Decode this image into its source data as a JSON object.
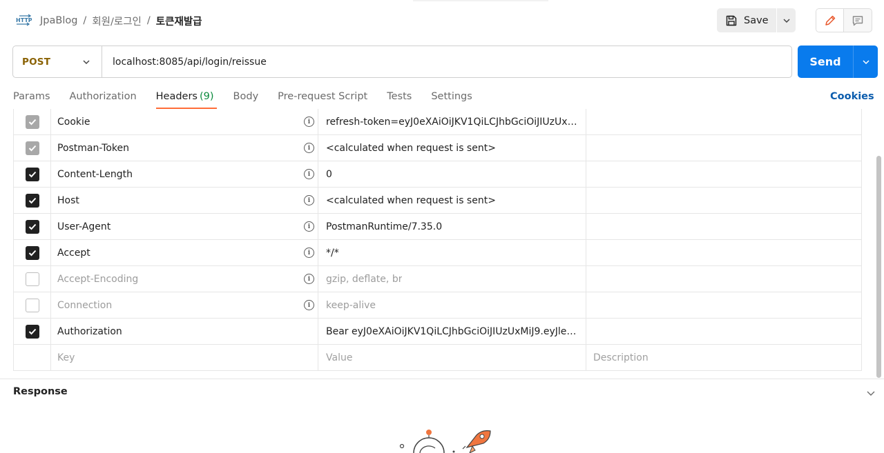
{
  "header": {
    "breadcrumb": [
      {
        "label": "JpaBlog",
        "kind": "crumb"
      },
      {
        "label": "회원/로그인",
        "kind": "crumb"
      },
      {
        "label": "토큰재발급",
        "kind": "current"
      }
    ],
    "separator": "/",
    "save_label": "Save",
    "icons": {
      "request_type": "http-icon",
      "save": "save-icon",
      "edit": "pencil-icon",
      "comment": "comment-icon"
    }
  },
  "request": {
    "method": "POST",
    "url": "localhost:8085/api/login/reissue",
    "send_label": "Send"
  },
  "tabs": [
    {
      "label": "Params"
    },
    {
      "label": "Authorization"
    },
    {
      "label": "Headers",
      "count": "(9)",
      "active": true
    },
    {
      "label": "Body"
    },
    {
      "label": "Pre-request Script"
    },
    {
      "label": "Tests"
    },
    {
      "label": "Settings"
    }
  ],
  "cookies_label": "Cookies",
  "headers": {
    "rows": [
      {
        "key": "Cookie",
        "value": "refresh-token=eyJ0eXAiOiJKV1QiLCJhbGciOiJIUzUxMi...",
        "state": "gray",
        "info": true,
        "disabled": false
      },
      {
        "key": "Postman-Token",
        "value": "<calculated when request is sent>",
        "state": "gray",
        "info": true,
        "disabled": false
      },
      {
        "key": "Content-Length",
        "value": "0",
        "state": "on",
        "info": true,
        "disabled": false
      },
      {
        "key": "Host",
        "value": "<calculated when request is sent>",
        "state": "on",
        "info": true,
        "disabled": false
      },
      {
        "key": "User-Agent",
        "value": "PostmanRuntime/7.35.0",
        "state": "on",
        "info": true,
        "disabled": false
      },
      {
        "key": "Accept",
        "value": "*/*",
        "state": "on",
        "info": true,
        "disabled": false
      },
      {
        "key": "Accept-Encoding",
        "value": "gzip, deflate, br",
        "state": "off",
        "info": true,
        "disabled": true
      },
      {
        "key": "Connection",
        "value": "keep-alive",
        "state": "off",
        "info": true,
        "disabled": true
      },
      {
        "key": "Authorization",
        "value": "Bear eyJ0eXAiOiJKV1QiLCJhbGciOiJIUzUxMiJ9.eyJleH...",
        "state": "on",
        "info": false,
        "disabled": false
      }
    ],
    "placeholder": {
      "key": "Key",
      "value": "Value",
      "description": "Description"
    }
  },
  "response": {
    "title": "Response"
  },
  "colors": {
    "send": "#097bed",
    "method": "#8a6204",
    "active_tab_underline": "#ff6c37",
    "header_count": "#0a8a3c",
    "cookies_link": "#0b5cad",
    "edit_icon": "#e8562a"
  }
}
